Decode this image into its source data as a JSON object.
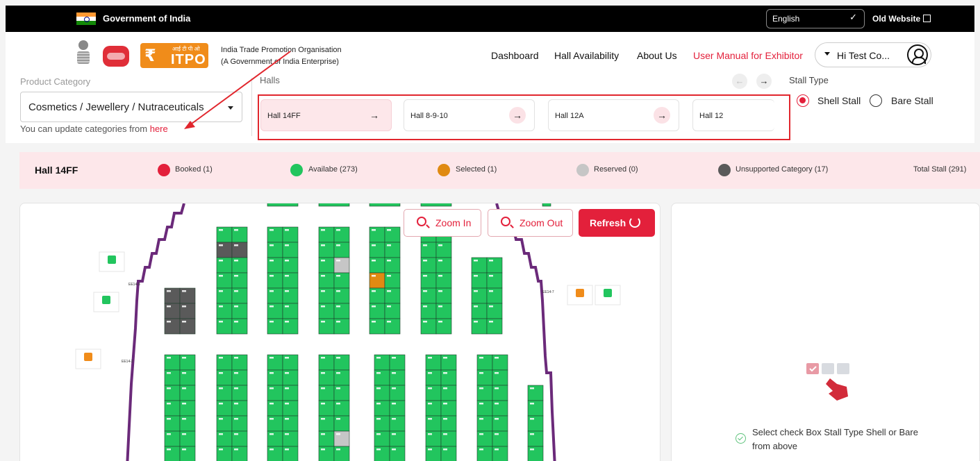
{
  "gov_bar": {
    "title": "Government of India",
    "language": "English",
    "old_website": "Old Website"
  },
  "header": {
    "itpo_hindi": "आई टी पी ओ",
    "itpo_logo": "ITPO",
    "org_name": "India Trade Promotion Organisation",
    "org_sub": "(A Government of India Enterprise)",
    "nav": [
      "Dashboard",
      "Hall Availability",
      "About Us",
      "User Manual for Exhibitor"
    ],
    "user_label": "Hi Test Co..."
  },
  "filters": {
    "category_label": "Product Category",
    "category_value": "Cosmetics / Jewellery / Nutraceuticals",
    "hint_text": "You can update categories from",
    "hint_link": "here",
    "halls_label": "Halls",
    "halls": [
      {
        "name": "Hall 14FF",
        "active": true
      },
      {
        "name": "Hall 8-9-10",
        "active": false
      },
      {
        "name": "Hall 12A",
        "active": false
      },
      {
        "name": "Hall 12",
        "active": false
      }
    ],
    "stall_type_label": "Stall Type",
    "stall_types": [
      {
        "label": "Shell Stall",
        "selected": true
      },
      {
        "label": "Bare Stall",
        "selected": false
      }
    ]
  },
  "legend": {
    "hall": "Hall 14FF",
    "items": [
      {
        "label": "Booked (1)",
        "color": "#e3203b"
      },
      {
        "label": "Availabe (273)",
        "color": "#22c55e"
      },
      {
        "label": "Selected (1)",
        "color": "#e08a12"
      },
      {
        "label": "Reserved (0)",
        "color": "#c6c6c6"
      },
      {
        "label": "Unsupported Category (17)",
        "color": "#5a5a5a"
      }
    ],
    "total": "Total Stall (291)"
  },
  "map": {
    "zoom_in": "Zoom In",
    "zoom_out": "Zoom Out",
    "refresh": "Refresh",
    "labels": {
      "e1": "EE14-3",
      "e2": "EE14-2",
      "e3": "EE14-7"
    }
  },
  "panel": {
    "message": "Select check Box Stall Type Shell or Bare from above"
  },
  "colors": {
    "accent": "#e3203b",
    "available": "#22c55e",
    "boundary": "#6b2a7a"
  }
}
